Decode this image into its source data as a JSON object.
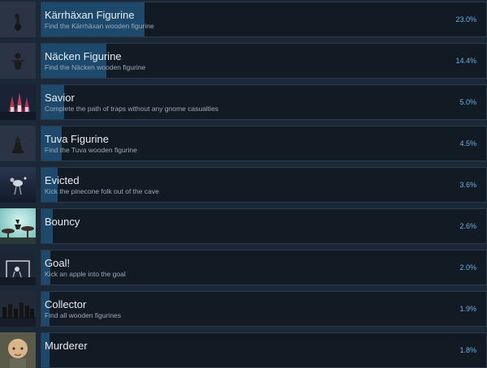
{
  "achievements": [
    {
      "title": "Kärrhäxan Figurine",
      "desc": "Find the Kärrhäxan wooden figurine",
      "percent": "23.0%",
      "fill": 0.23,
      "icon": "figurine-icon",
      "bg": "#2b3445"
    },
    {
      "title": "Näcken Figurine",
      "desc": "Find the Näcken wooden figurine",
      "percent": "14.4%",
      "fill": 0.144,
      "icon": "figurine-icon",
      "bg": "#2b3445"
    },
    {
      "title": "Savior",
      "desc": "Complete the path of traps without any gnome casualties",
      "percent": "5.0%",
      "fill": 0.05,
      "icon": "gnome-icon",
      "bg": "#1a2236"
    },
    {
      "title": "Tuva Figurine",
      "desc": "Find the Tuva wooden figurine",
      "percent": "4.5%",
      "fill": 0.045,
      "icon": "figurine-icon",
      "bg": "#2b3445"
    },
    {
      "title": "Evicted",
      "desc": "Kick the pinecone folk out of the cave",
      "percent": "3.6%",
      "fill": 0.036,
      "icon": "creature-icon",
      "bg": "#1f2738"
    },
    {
      "title": "Bouncy",
      "desc": "",
      "percent": "2.6%",
      "fill": 0.026,
      "icon": "mushroom-icon",
      "bg": "#7fc7c4"
    },
    {
      "title": "Goal!",
      "desc": "Kick an apple into the goal",
      "percent": "2.0%",
      "fill": 0.02,
      "icon": "goal-icon",
      "bg": "#1e2534"
    },
    {
      "title": "Collector",
      "desc": "Find all wooden figurines",
      "percent": "1.9%",
      "fill": 0.019,
      "icon": "figurines-group-icon",
      "bg": "#222a38"
    },
    {
      "title": "Murderer",
      "desc": "",
      "percent": "1.8%",
      "fill": 0.018,
      "icon": "child-portrait-icon",
      "bg": "#6d6a55"
    }
  ]
}
